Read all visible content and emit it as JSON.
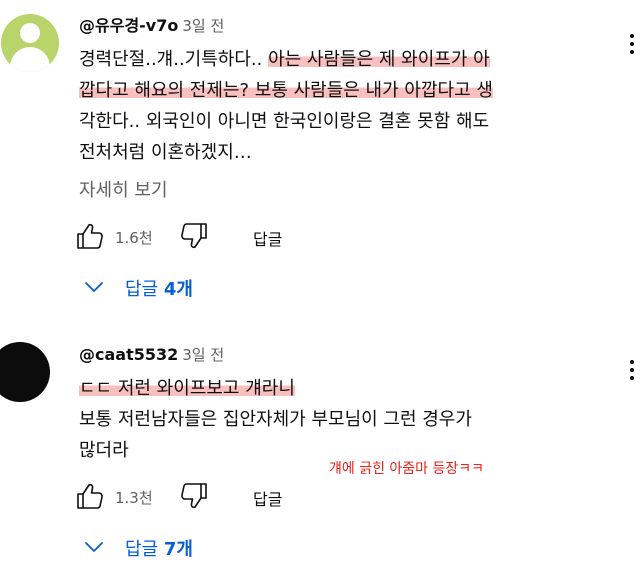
{
  "comments": [
    {
      "handle": "@유우경-v7o",
      "time": "3일 전",
      "lines": [
        {
          "plain": "경력단절..걔..기특하다.. ",
          "highlight": "아는 사람들은 제 와이프가 아"
        },
        {
          "plain": "",
          "highlight": "깝다고 해요의 전제는? 보통 사람들은 내가 아깝다고 생"
        },
        {
          "plain": "각한다.. 외국인이 아니면 한국인이랑은 결혼 못함 해도",
          "highlight": ""
        },
        {
          "plain": "전처처럼 이혼하겠지…",
          "highlight": ""
        }
      ],
      "read_more": "자세히 보기",
      "like_count": "1.6천",
      "reply_label": "답글",
      "replies_toggle": {
        "prefix": "답글 ",
        "count": "4개"
      }
    },
    {
      "handle": "@caat5532",
      "time": "3일 전",
      "lines": [
        {
          "plain": "",
          "highlight": "ㄷㄷ 저런 와이프보고 걔라니 "
        },
        {
          "plain": "보통 저런남자들은 집안자체가 부모님이 그런 경우가",
          "highlight": ""
        },
        {
          "plain": "많더라",
          "highlight": ""
        }
      ],
      "like_count": "1.3천",
      "reply_label": "답글",
      "replies_toggle": {
        "prefix": "답글 ",
        "count": "7개"
      }
    }
  ],
  "annotation": "걔에 긁힌 아줌마 등장ㅋㅋ",
  "colors": {
    "link_blue": "#065fd4",
    "highlight_pink": "#f6aaaa",
    "annotation_red": "#e8211b",
    "avatar_green": "#b9d46a"
  }
}
